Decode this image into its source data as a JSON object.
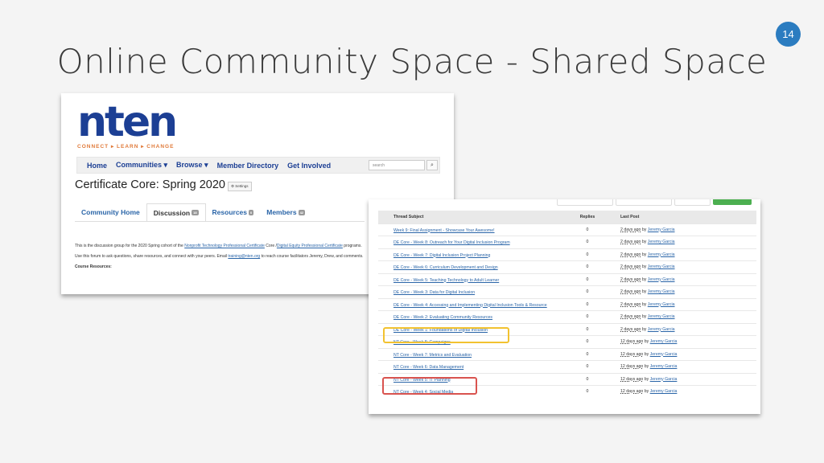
{
  "slide": {
    "title": "Online Community Space - Shared Space",
    "page_number": "14"
  },
  "community": {
    "logo_text": "nten",
    "logo_tagline": "CONNECT ▸ LEARN ▸ CHANGE",
    "nav": [
      "Home",
      "Communities ▾",
      "Browse ▾",
      "Member Directory",
      "Get Involved"
    ],
    "search_placeholder": "search",
    "heading": "Certificate Core: Spring 2020",
    "settings_label": "⚙ Settings",
    "tabs": [
      {
        "label": "Community Home",
        "badge": null
      },
      {
        "label": "Discussion",
        "badge": "18"
      },
      {
        "label": "Resources",
        "badge": "0"
      },
      {
        "label": "Members",
        "badge": "42"
      }
    ],
    "intro_1a": "This is the discussion group for the 2020 Spring cohort of the ",
    "intro_link1": "Nonprofit Technology Professional Certificate",
    "intro_1b": " Core /",
    "intro_link2": "Digital Equity Professional Certificate",
    "intro_1c": " programs.",
    "intro_2a": "Use this forum to ask questions, share resources, and connect with your peers. Email ",
    "intro_email": "training@nten.org",
    "intro_2b": " to reach course facilitators Jeremy, Drew, and comments.",
    "resources_heading": "Course Resources:"
  },
  "threads": {
    "headers": {
      "subject": "Thread Subject",
      "replies": "Replies",
      "last_post": "Last Post"
    },
    "by": "by",
    "rows": [
      {
        "subject": "Week 9: Final Assignment - Showcase Your Awesome!",
        "replies": "0",
        "ago": "2 days ago",
        "author": "Jeremy Garcia"
      },
      {
        "subject": "DE Core - Week 8: Outreach for Your Digital Inclusion Program",
        "replies": "0",
        "ago": "2 days ago",
        "author": "Jeremy Garcia"
      },
      {
        "subject": "DE Core - Week 7: Digital Inclusion Project Planning",
        "replies": "0",
        "ago": "2 days ago",
        "author": "Jeremy Garcia"
      },
      {
        "subject": "DE Core - Week 6: Curriculum Development and Design",
        "replies": "0",
        "ago": "2 days ago",
        "author": "Jeremy Garcia"
      },
      {
        "subject": "DE Core - Week 5: Teaching Technology to Adult Learner",
        "replies": "0",
        "ago": "2 days ago",
        "author": "Jeremy Garcia"
      },
      {
        "subject": "DE Core - Week 3: Data for Digital Inclusion",
        "replies": "0",
        "ago": "2 days ago",
        "author": "Jeremy Garcia"
      },
      {
        "subject": "DE Core - Week 4: Accessing and Implementing Digital Inclusion Tools & Resource",
        "replies": "0",
        "ago": "2 days ago",
        "author": "Jeremy Garcia"
      },
      {
        "subject": "DE Core - Week 2: Evaluating Community Resources",
        "replies": "0",
        "ago": "2 days ago",
        "author": "Jeremy Garcia"
      },
      {
        "subject": "DE Core - Week 1: Foundations of Digital Inclusion",
        "replies": "0",
        "ago": "2 days ago",
        "author": "Jeremy Garcia"
      },
      {
        "subject": "NT Core - Week 8: Campaigns",
        "replies": "0",
        "ago": "12 days ago",
        "author": "Jeremy Garcia"
      },
      {
        "subject": "NT Core - Week 7: Metrics and Evaluation",
        "replies": "0",
        "ago": "12 days ago",
        "author": "Jeremy Garcia"
      },
      {
        "subject": "NT Core - Week 6: Data Management",
        "replies": "0",
        "ago": "12 days ago",
        "author": "Jeremy Garcia"
      },
      {
        "subject": "NT Core - Week 5: IT Planning",
        "replies": "0",
        "ago": "12 days ago",
        "author": "Jeremy Garcia"
      },
      {
        "subject": "NT Core - Week 4: Social Media",
        "replies": "0",
        "ago": "12 days ago",
        "author": "Jeremy Garcia"
      }
    ]
  },
  "colors": {
    "highlight_yellow": "#f2c230",
    "highlight_red": "#d9534f",
    "brand_blue": "#1c3f94",
    "accent_orange": "#e07a3a"
  }
}
